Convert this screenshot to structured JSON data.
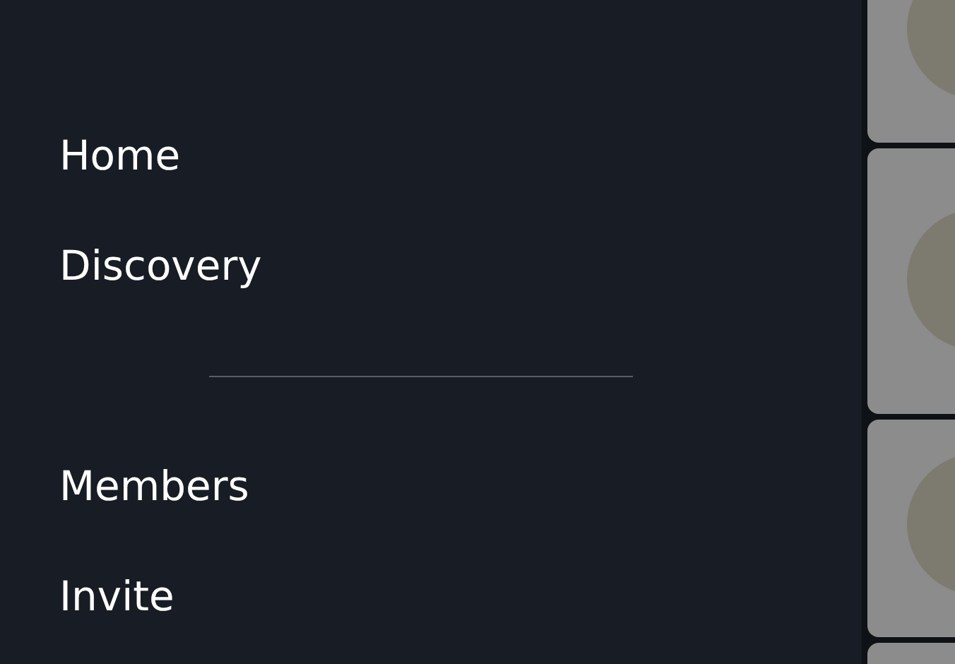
{
  "drawer": {
    "sections": [
      {
        "items": [
          {
            "label": "Home"
          },
          {
            "label": "Discovery"
          }
        ]
      },
      {
        "items": [
          {
            "label": "Members"
          },
          {
            "label": "Invite"
          }
        ]
      }
    ]
  }
}
